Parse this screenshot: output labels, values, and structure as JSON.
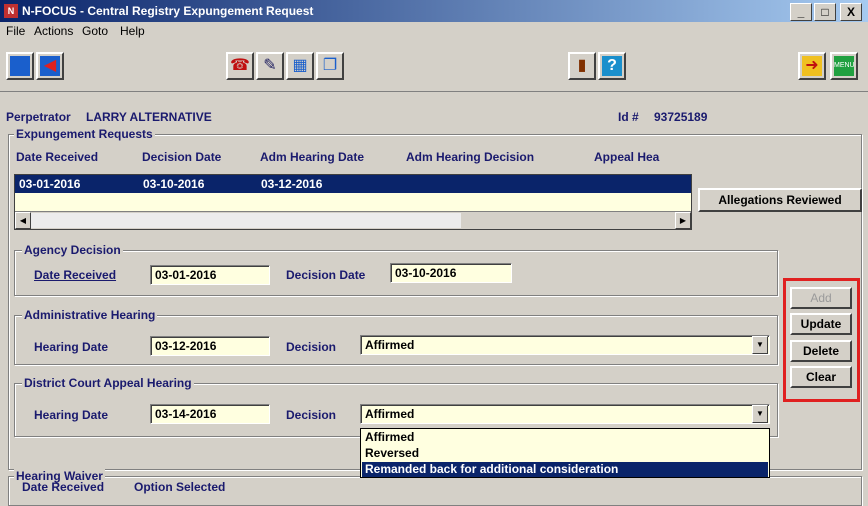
{
  "window": {
    "title": "N-FOCUS - Central Registry Expungement Request",
    "min": "_",
    "max": "□",
    "close": "X"
  },
  "menu": [
    "File",
    "Actions",
    "Goto",
    "Help"
  ],
  "perpetrator": {
    "label": "Perpetrator",
    "name": "LARRY ALTERNATIVE",
    "id_label": "Id #",
    "id": "93725189"
  },
  "requests": {
    "title": "Expungement Requests",
    "columns": [
      "Date Received",
      "Decision Date",
      "Adm Hearing Date",
      "Adm Hearing Decision",
      "Appeal Hea"
    ],
    "rows": [
      {
        "date_received": "03-01-2016",
        "decision_date": "03-10-2016",
        "adm_hearing_date": "03-12-2016"
      }
    ],
    "allegations_button": "Allegations Reviewed"
  },
  "agency": {
    "title": "Agency Decision",
    "date_received_label": "Date Received",
    "date_received": "03-01-2016",
    "decision_date_label": "Decision Date",
    "decision_date": "03-10-2016"
  },
  "admin": {
    "title": "Administrative Hearing",
    "hearing_date_label": "Hearing Date",
    "hearing_date": "03-12-2016",
    "decision_label": "Decision",
    "decision": "Affirmed"
  },
  "district": {
    "title": "District Court Appeal Hearing",
    "hearing_date_label": "Hearing Date",
    "hearing_date": "03-14-2016",
    "decision_label": "Decision",
    "decision": "Affirmed",
    "options": [
      "Affirmed",
      "Reversed",
      "Remanded back for additional consideration"
    ]
  },
  "waiver": {
    "title": "Hearing Waiver",
    "col1": "Date Received",
    "col2": "Option Selected"
  },
  "actions": {
    "add": "Add",
    "update": "Update",
    "delete": "Delete",
    "clear": "Clear"
  },
  "colors": {
    "selection": "#0a246a",
    "field_bg": "#ffffe0",
    "highlight_border": "#e02020"
  }
}
